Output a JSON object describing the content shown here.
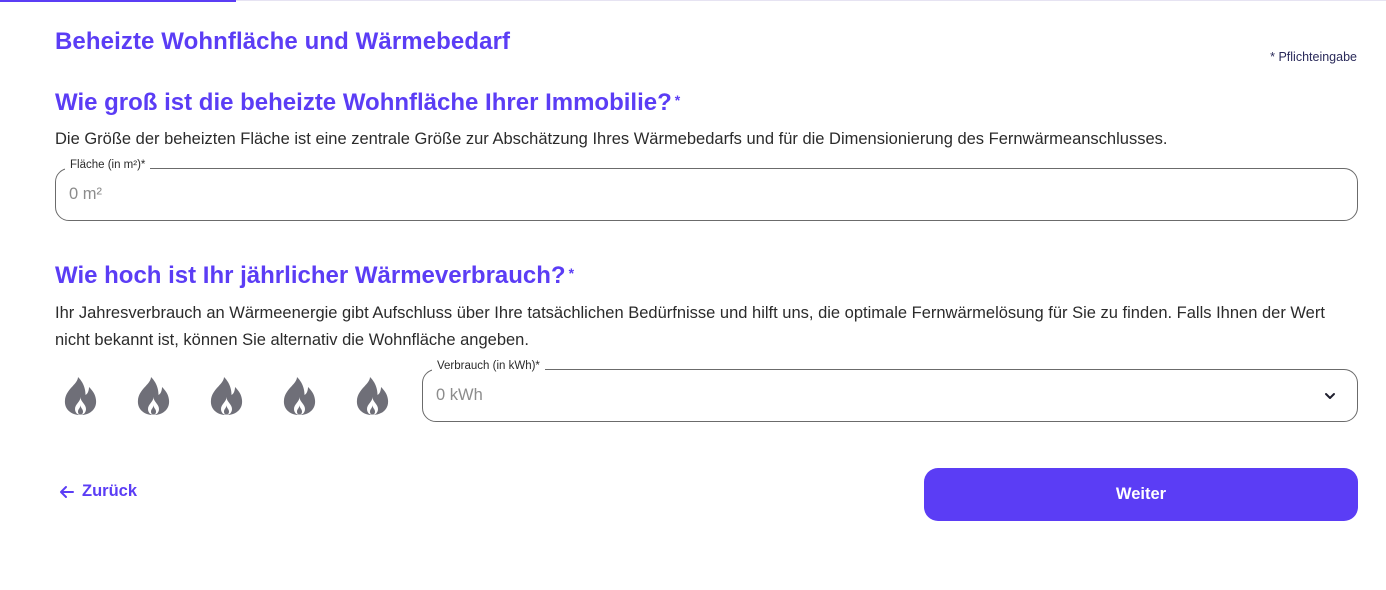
{
  "progress": {
    "fraction": 0.17
  },
  "section": {
    "title": "Beheizte Wohnfläche und Wärmebedarf",
    "required_note": "* Pflichteingabe"
  },
  "area_question": {
    "title": "Wie groß ist die beheizte Wohnfläche Ihrer Immobilie?",
    "required_mark": "*",
    "description": "Die Größe der beheizten Fläche ist eine zentrale Größe zur Abschätzung Ihres Wärmebedarfs und für die Dimensionierung des Fernwärmeanschlusses.",
    "field_label": "Fläche (in m²)*",
    "field_placeholder": "0 m²",
    "field_value": ""
  },
  "consumption_question": {
    "title": "Wie hoch ist Ihr jährlicher Wärmeverbrauch?",
    "required_mark": "*",
    "description": "Ihr Jahresverbrauch an Wärmeenergie gibt Aufschluss über Ihre tatsächlichen Bedürfnisse und hilft uns, die optimale Fernwärmelösung für Sie zu finden. Falls Ihnen der Wert nicht bekannt ist, können Sie alternativ die Wohnfläche angeben.",
    "field_label": "Verbrauch (in kWh)*",
    "field_placeholder": "0 kWh",
    "field_value": "",
    "flame_rating": {
      "max": 5,
      "selected": 0,
      "icon": "flame-icon",
      "color": "#6f6f78"
    }
  },
  "navigation": {
    "back_label": "Zurück",
    "next_label": "Weiter"
  },
  "colors": {
    "accent": "#5b3df5",
    "text": "#2b2b2b",
    "border": "#6b6b6b"
  }
}
